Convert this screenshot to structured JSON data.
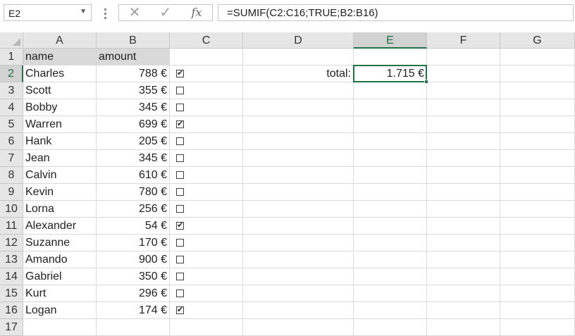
{
  "name_box": "E2",
  "formula": "=SUMIF(C2:C16;TRUE;B2:B16)",
  "icons": {
    "cancel": "close-icon",
    "enter": "checkmark-icon",
    "function": "fx-icon"
  },
  "fx_label": "fx",
  "columns": [
    "A",
    "B",
    "C",
    "D",
    "E",
    "F",
    "G"
  ],
  "rows": [
    "1",
    "2",
    "3",
    "4",
    "5",
    "6",
    "7",
    "8",
    "9",
    "10",
    "11",
    "12",
    "13",
    "14",
    "15",
    "16",
    "17"
  ],
  "headers": {
    "name": "name",
    "amount": "amount"
  },
  "data": [
    {
      "name": "Charles",
      "amount": "788 €",
      "checked": true
    },
    {
      "name": "Scott",
      "amount": "355 €",
      "checked": false
    },
    {
      "name": "Bobby",
      "amount": "345 €",
      "checked": false
    },
    {
      "name": "Warren",
      "amount": "699 €",
      "checked": true
    },
    {
      "name": "Hank",
      "amount": "205 €",
      "checked": false
    },
    {
      "name": "Jean",
      "amount": "345 €",
      "checked": false
    },
    {
      "name": "Calvin",
      "amount": "610 €",
      "checked": false
    },
    {
      "name": "Kevin",
      "amount": "780 €",
      "checked": false
    },
    {
      "name": "Lorna",
      "amount": "256 €",
      "checked": false
    },
    {
      "name": "Alexander",
      "amount": "54 €",
      "checked": true
    },
    {
      "name": "Suzanne",
      "amount": "170 €",
      "checked": false
    },
    {
      "name": "Amando",
      "amount": "900 €",
      "checked": false
    },
    {
      "name": "Gabriel",
      "amount": "350 €",
      "checked": false
    },
    {
      "name": "Kurt",
      "amount": "296 €",
      "checked": false
    },
    {
      "name": "Logan",
      "amount": "174 €",
      "checked": true
    }
  ],
  "total": {
    "label": "total:",
    "value": "1.715 €"
  },
  "colors": {
    "accent": "#217346",
    "header_bg": "#e6e6e6",
    "header_fill": "#d9d9d9"
  }
}
